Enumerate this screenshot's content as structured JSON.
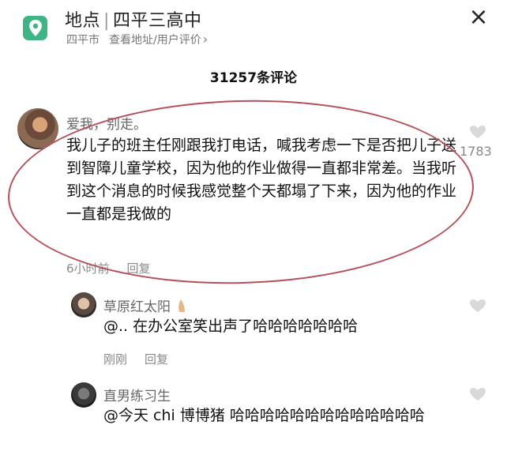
{
  "location": {
    "label": "地点",
    "name": "四平三高中",
    "city": "四平市",
    "link": "查看地址/用户评价"
  },
  "comment_count": "31257条评论",
  "main_comment": {
    "username": "爱我，别走。",
    "text": "我儿子的班主任刚跟我打电话，喊我考虑一下是否把儿子送到智障儿童学校，因为他的作业做得一直都非常差。当我听到这个消息的时候我感觉整个天都塌了下来，因为他的作业一直都是我做的",
    "time": "6小时前",
    "reply_label": "回复",
    "likes": "1783"
  },
  "replies": [
    {
      "username": "草原红太阳",
      "text": "@.. 在办公室笑出声了哈哈哈哈哈哈哈",
      "time": "刚刚",
      "reply_label": "回复"
    },
    {
      "username": "直男练习生",
      "text": "@今天 chi 博博猪  哈哈哈哈哈哈哈哈哈哈哈哈哈"
    }
  ],
  "colors": {
    "location_icon": "#3fb585",
    "annotation_circle": "#b5505a"
  },
  "icons": {
    "location": "location-pin-icon",
    "close": "close-icon",
    "like": "heart-icon"
  }
}
